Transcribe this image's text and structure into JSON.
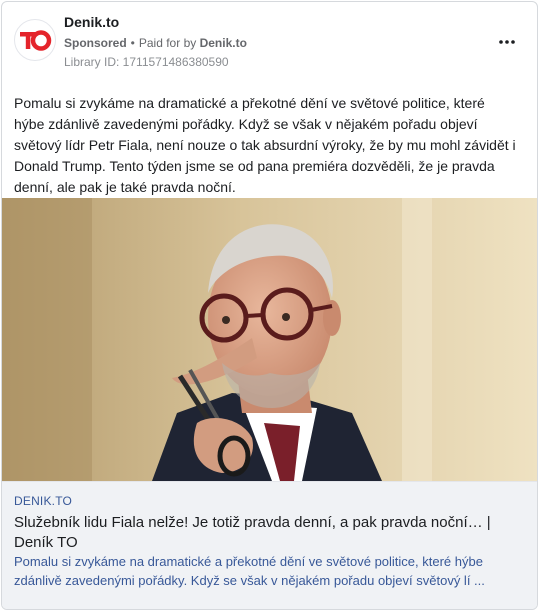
{
  "header": {
    "page_name": "Denik.to",
    "sponsored_label": "Sponsored",
    "separator": "•",
    "paid_for_label": "Paid for by",
    "paid_for_name": "Denik.to",
    "library_id": "Library ID: 1711571486380590",
    "logo_text": "TO",
    "more_icon": "more-horizontal-icon"
  },
  "post": {
    "text": "Pomalu si zvykáme na dramatické a překotné dění ve světové politice, které hýbe zdánlivě zavedenými pořádky. Když se však v nějakém pořadu objeví světový lídr Petr Fiala, není nouze o tak absurdní výroky, že by mu mohl závidět i Donald Trump. Tento týden jsme se od pana premiéra dozvěděli, že je pravda denní, ale pak je také pravda noční."
  },
  "link": {
    "domain": "DENIK.TO",
    "title": "Služebník lidu Fiala nelže! Je totiž pravda denní, a pak pravda noční… | Deník TO",
    "description": "Pomalu si zvykáme na dramatické a překotné dění ve světové politice, které hýbe zdánlivě zavedenými pořádky. Když se však v nějakém pořadu objeví světový lí ..."
  },
  "colors": {
    "brand_red": "#e4242b",
    "link_blue": "#385898",
    "meta_gray": "#65676b"
  }
}
